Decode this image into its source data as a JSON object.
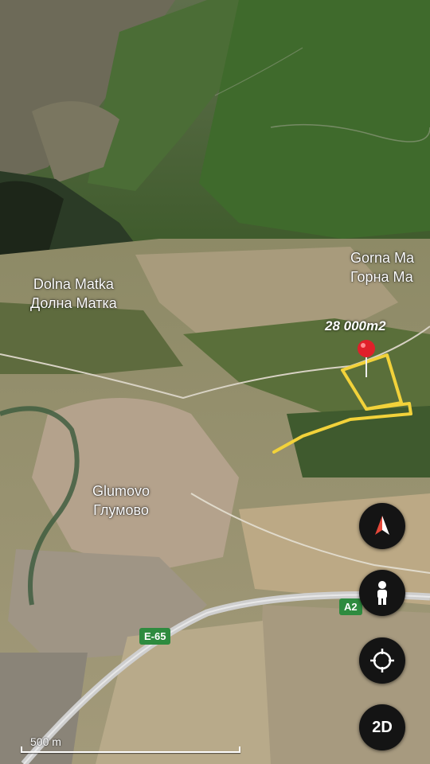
{
  "map": {
    "view": "3D satellite",
    "places": [
      {
        "id": "dolna-matka",
        "latin": "Dolna Matka",
        "cyrillic": "Долна Матка"
      },
      {
        "id": "gorna-matka",
        "latin": "Gorna Ma",
        "cyrillic": "Горна Ма"
      },
      {
        "id": "glumovo",
        "latin": "Glumovo",
        "cyrillic": "Глумово"
      }
    ],
    "parcel": {
      "area_label": "28 000m2",
      "outline_color": "#f2d23a"
    },
    "pin": {
      "color": "#e0202a",
      "icon": "map-pin-icon"
    },
    "roads": [
      {
        "id": "e65",
        "label": "E-65",
        "color": "#2e8b3f"
      },
      {
        "id": "a2",
        "label": "A2",
        "color": "#2e8b3f"
      }
    ]
  },
  "controls": {
    "compass": {
      "icon": "compass-icon"
    },
    "street_view": {
      "icon": "pegman-icon"
    },
    "my_location": {
      "icon": "location-target-icon"
    },
    "view_toggle": {
      "label": "2D"
    }
  },
  "scale": {
    "label": "500 m"
  },
  "colors": {
    "control_bg": "#141414",
    "control_fg": "#ffffff"
  }
}
